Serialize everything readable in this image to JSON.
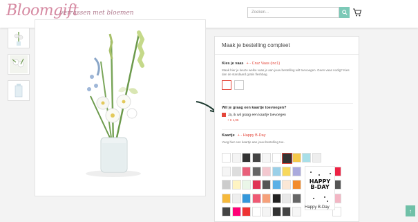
{
  "header": {
    "logo_text": "Bloomgift",
    "tagline": "...verrassen met bloemen",
    "search_placeholder": "Zoeken..."
  },
  "panel": {
    "title": "Maak je bestelling compleet",
    "vase": {
      "heading": "Kies je vaas",
      "selection": "+ - Cruz Vaas (inc1)",
      "description": "Maak hier je keuze welke vaas je aan jouw bestelling wilt toevoegen. Geen vaas nodig? Kies dan de standaard gratis fleshbag."
    },
    "card_question": {
      "heading": "Wil je graag een kaartje toevoegen?",
      "option": "Ja, ik wil graag een kaartje toevoegen",
      "price": "+ € 1,95"
    },
    "kaartje": {
      "heading": "Kaartje",
      "selection": "+ - Happy B-Day",
      "description": "Voeg hier een kaartje aan jouw bestelling toe."
    },
    "preview": {
      "text": "HAPPY B-DAY",
      "label": "Happy B-Day"
    }
  },
  "colors": {
    "accent": "#e4463a",
    "brand_green": "#7cc9b7",
    "logo_pink": "#d68aa2"
  }
}
